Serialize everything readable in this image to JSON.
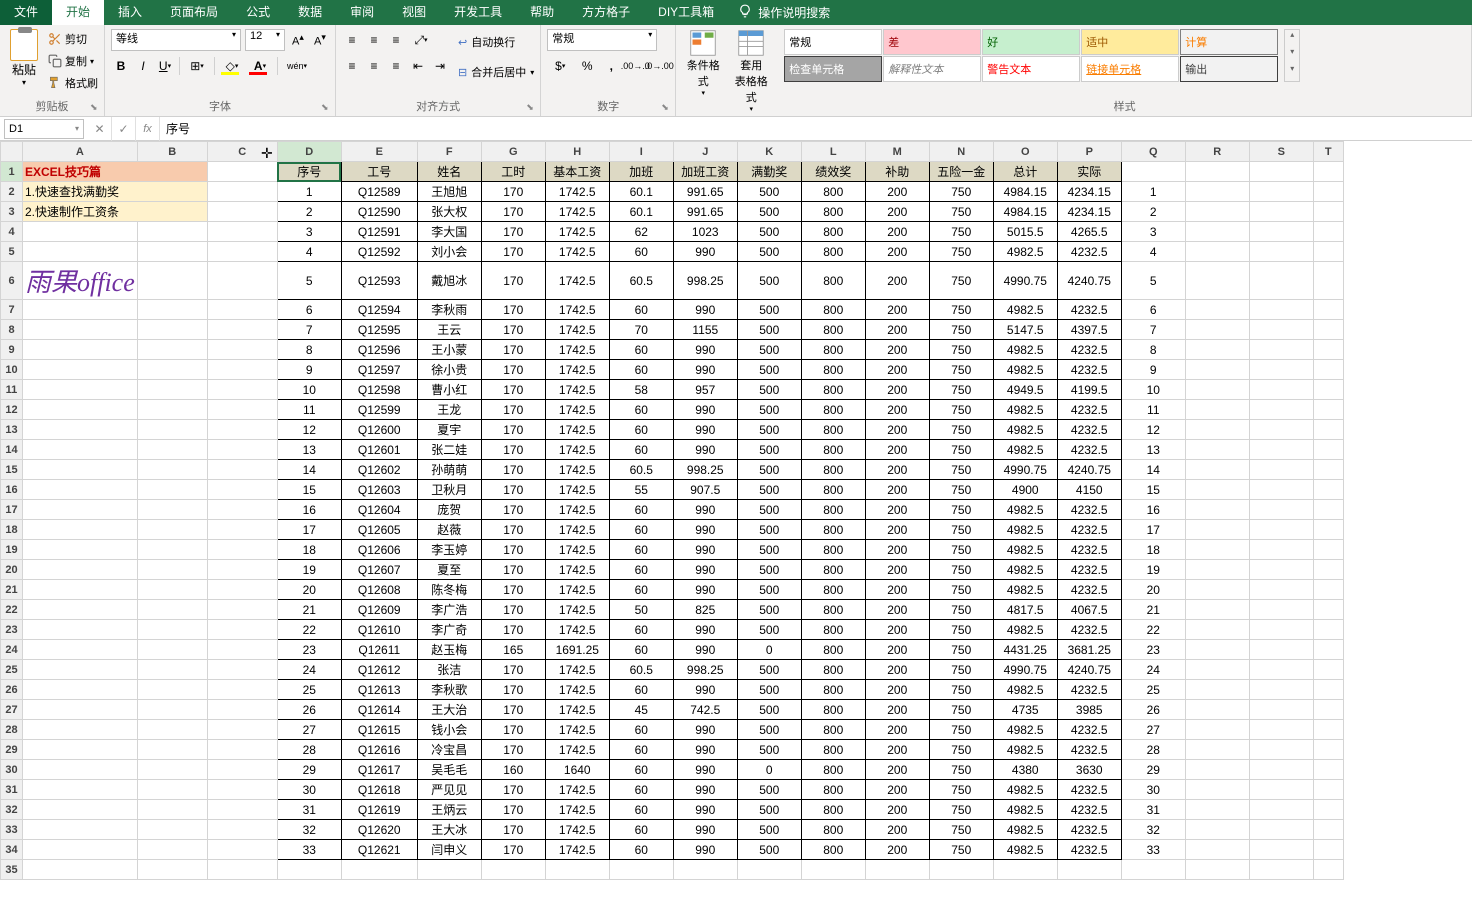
{
  "tabs": {
    "file": "文件",
    "items": [
      "开始",
      "插入",
      "页面布局",
      "公式",
      "数据",
      "审阅",
      "视图",
      "开发工具",
      "帮助",
      "方方格子",
      "DIY工具箱"
    ],
    "active_index": 0,
    "tell_me": "操作说明搜索"
  },
  "ribbon": {
    "clipboard": {
      "paste": "粘贴",
      "cut": "剪切",
      "copy": "复制",
      "format_painter": "格式刷",
      "title": "剪贴板"
    },
    "font": {
      "name": "等线",
      "size": "12",
      "title": "字体",
      "wen": "wén"
    },
    "alignment": {
      "wrap": "自动换行",
      "merge": "合并后居中",
      "title": "对齐方式"
    },
    "number": {
      "format": "常规",
      "title": "数字"
    },
    "condformat": {
      "cf": "条件格式",
      "table": "套用\n表格格式",
      "title": ""
    },
    "styles": {
      "title": "样式",
      "cells": [
        {
          "label": "常规",
          "bg": "#ffffff",
          "fg": "#000000",
          "border": "#ccc"
        },
        {
          "label": "差",
          "bg": "#ffc7ce",
          "fg": "#9c0006",
          "border": "#ccc"
        },
        {
          "label": "好",
          "bg": "#c6efce",
          "fg": "#006100",
          "border": "#ccc"
        },
        {
          "label": "适中",
          "bg": "#ffeb9c",
          "fg": "#9c5700",
          "border": "#ccc"
        },
        {
          "label": "计算",
          "bg": "#f2f2f2",
          "fg": "#fa7d00",
          "border": "#7f7f7f"
        },
        {
          "label": "检查单元格",
          "bg": "#a5a5a5",
          "fg": "#ffffff",
          "border": "#3f3f3f"
        },
        {
          "label": "解释性文本",
          "bg": "#ffffff",
          "fg": "#7f7f7f",
          "border": "#ccc",
          "italic": true
        },
        {
          "label": "警告文本",
          "bg": "#ffffff",
          "fg": "#ff0000",
          "border": "#ccc"
        },
        {
          "label": "链接单元格",
          "bg": "#ffffff",
          "fg": "#fa7d00",
          "border": "#ccc",
          "underline": true
        },
        {
          "label": "输出",
          "bg": "#f2f2f2",
          "fg": "#3f3f3f",
          "border": "#3f3f3f"
        }
      ]
    }
  },
  "formula_bar": {
    "name_box": "D1",
    "value": "序号"
  },
  "columns": [
    "A",
    "B",
    "C",
    "D",
    "E",
    "F",
    "G",
    "H",
    "I",
    "J",
    "K",
    "L",
    "M",
    "N",
    "O",
    "P",
    "Q",
    "R",
    "S",
    "T"
  ],
  "selected_cell": "D1",
  "left_panel": {
    "title": "EXCEL技巧篇",
    "tip1": "1.快速查找满勤奖",
    "tip2": "2.快速制作工资条",
    "watermark": "雨果office"
  },
  "chart_data": {
    "type": "table",
    "headers": [
      "序号",
      "工号",
      "姓名",
      "工时",
      "基本工资",
      "加班",
      "加班工资",
      "满勤奖",
      "绩效奖",
      "补助",
      "五险一金",
      "总计",
      "实际"
    ],
    "q_column_header": "",
    "rows": [
      [
        1,
        "Q12589",
        "王旭旭",
        170,
        1742.5,
        60.1,
        991.65,
        500,
        800,
        200,
        750,
        4984.15,
        4234.15,
        1
      ],
      [
        2,
        "Q12590",
        "张大权",
        170,
        1742.5,
        60.1,
        991.65,
        500,
        800,
        200,
        750,
        4984.15,
        4234.15,
        2
      ],
      [
        3,
        "Q12591",
        "李大国",
        170,
        1742.5,
        62,
        1023,
        500,
        800,
        200,
        750,
        5015.5,
        4265.5,
        3
      ],
      [
        4,
        "Q12592",
        "刘小会",
        170,
        1742.5,
        60,
        990,
        500,
        800,
        200,
        750,
        4982.5,
        4232.5,
        4
      ],
      [
        5,
        "Q12593",
        "戴旭冰",
        170,
        1742.5,
        60.5,
        998.25,
        500,
        800,
        200,
        750,
        4990.75,
        4240.75,
        5
      ],
      [
        6,
        "Q12594",
        "李秋雨",
        170,
        1742.5,
        60,
        990,
        500,
        800,
        200,
        750,
        4982.5,
        4232.5,
        6
      ],
      [
        7,
        "Q12595",
        "王云",
        170,
        1742.5,
        70,
        1155,
        500,
        800,
        200,
        750,
        5147.5,
        4397.5,
        7
      ],
      [
        8,
        "Q12596",
        "王小蒙",
        170,
        1742.5,
        60,
        990,
        500,
        800,
        200,
        750,
        4982.5,
        4232.5,
        8
      ],
      [
        9,
        "Q12597",
        "徐小贵",
        170,
        1742.5,
        60,
        990,
        500,
        800,
        200,
        750,
        4982.5,
        4232.5,
        9
      ],
      [
        10,
        "Q12598",
        "曹小红",
        170,
        1742.5,
        58,
        957,
        500,
        800,
        200,
        750,
        4949.5,
        4199.5,
        10
      ],
      [
        11,
        "Q12599",
        "王龙",
        170,
        1742.5,
        60,
        990,
        500,
        800,
        200,
        750,
        4982.5,
        4232.5,
        11
      ],
      [
        12,
        "Q12600",
        "夏宇",
        170,
        1742.5,
        60,
        990,
        500,
        800,
        200,
        750,
        4982.5,
        4232.5,
        12
      ],
      [
        13,
        "Q12601",
        "张二娃",
        170,
        1742.5,
        60,
        990,
        500,
        800,
        200,
        750,
        4982.5,
        4232.5,
        13
      ],
      [
        14,
        "Q12602",
        "孙萌萌",
        170,
        1742.5,
        60.5,
        998.25,
        500,
        800,
        200,
        750,
        4990.75,
        4240.75,
        14
      ],
      [
        15,
        "Q12603",
        "卫秋月",
        170,
        1742.5,
        55,
        907.5,
        500,
        800,
        200,
        750,
        4900,
        4150,
        15
      ],
      [
        16,
        "Q12604",
        "庞贺",
        170,
        1742.5,
        60,
        990,
        500,
        800,
        200,
        750,
        4982.5,
        4232.5,
        16
      ],
      [
        17,
        "Q12605",
        "赵薇",
        170,
        1742.5,
        60,
        990,
        500,
        800,
        200,
        750,
        4982.5,
        4232.5,
        17
      ],
      [
        18,
        "Q12606",
        "李玉婷",
        170,
        1742.5,
        60,
        990,
        500,
        800,
        200,
        750,
        4982.5,
        4232.5,
        18
      ],
      [
        19,
        "Q12607",
        "夏至",
        170,
        1742.5,
        60,
        990,
        500,
        800,
        200,
        750,
        4982.5,
        4232.5,
        19
      ],
      [
        20,
        "Q12608",
        "陈冬梅",
        170,
        1742.5,
        60,
        990,
        500,
        800,
        200,
        750,
        4982.5,
        4232.5,
        20
      ],
      [
        21,
        "Q12609",
        "李广浩",
        170,
        1742.5,
        50,
        825,
        500,
        800,
        200,
        750,
        4817.5,
        4067.5,
        21
      ],
      [
        22,
        "Q12610",
        "李广奇",
        170,
        1742.5,
        60,
        990,
        500,
        800,
        200,
        750,
        4982.5,
        4232.5,
        22
      ],
      [
        23,
        "Q12611",
        "赵玉梅",
        165,
        1691.25,
        60,
        990,
        0,
        800,
        200,
        750,
        4431.25,
        3681.25,
        23
      ],
      [
        24,
        "Q12612",
        "张洁",
        170,
        1742.5,
        60.5,
        998.25,
        500,
        800,
        200,
        750,
        4990.75,
        4240.75,
        24
      ],
      [
        25,
        "Q12613",
        "李秋歌",
        170,
        1742.5,
        60,
        990,
        500,
        800,
        200,
        750,
        4982.5,
        4232.5,
        25
      ],
      [
        26,
        "Q12614",
        "王大治",
        170,
        1742.5,
        45,
        742.5,
        500,
        800,
        200,
        750,
        4735,
        3985,
        26
      ],
      [
        27,
        "Q12615",
        "钱小会",
        170,
        1742.5,
        60,
        990,
        500,
        800,
        200,
        750,
        4982.5,
        4232.5,
        27
      ],
      [
        28,
        "Q12616",
        "冷宝昌",
        170,
        1742.5,
        60,
        990,
        500,
        800,
        200,
        750,
        4982.5,
        4232.5,
        28
      ],
      [
        29,
        "Q12617",
        "吴毛毛",
        160,
        1640,
        60,
        990,
        0,
        800,
        200,
        750,
        4380,
        3630,
        29
      ],
      [
        30,
        "Q12618",
        "严见见",
        170,
        1742.5,
        60,
        990,
        500,
        800,
        200,
        750,
        4982.5,
        4232.5,
        30
      ],
      [
        31,
        "Q12619",
        "王炳云",
        170,
        1742.5,
        60,
        990,
        500,
        800,
        200,
        750,
        4982.5,
        4232.5,
        31
      ],
      [
        32,
        "Q12620",
        "王大冰",
        170,
        1742.5,
        60,
        990,
        500,
        800,
        200,
        750,
        4982.5,
        4232.5,
        32
      ],
      [
        33,
        "Q12621",
        "闫申义",
        170,
        1742.5,
        60,
        990,
        500,
        800,
        200,
        750,
        4982.5,
        4232.5,
        33
      ]
    ]
  }
}
